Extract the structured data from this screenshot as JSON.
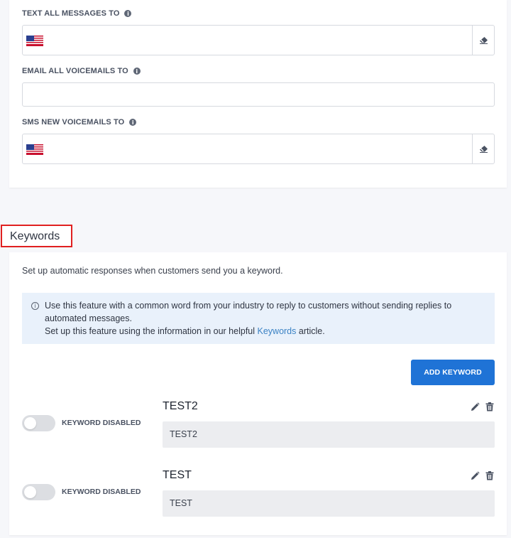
{
  "forwarding": {
    "text_messages_label": "TEXT ALL MESSAGES TO",
    "email_voicemails_label": "EMAIL ALL VOICEMAILS TO",
    "sms_voicemails_label": "SMS NEW VOICEMAILS TO",
    "text_messages_value": "",
    "email_voicemails_value": "",
    "sms_voicemails_value": "",
    "flag_icon": "us-flag-icon",
    "clear_icon": "eraser-icon",
    "info_icon": "info-icon"
  },
  "keywords": {
    "title": "Keywords",
    "description": "Set up automatic responses when customers send you a keyword.",
    "info_line1": "Use this feature with a common word from your industry to reply to customers without sending replies to",
    "info_line2": "automated messages.",
    "info_line3_prefix": "Set up this feature using the information in our helpful ",
    "info_link": "Keywords",
    "info_line3_suffix": " article.",
    "add_button": "ADD KEYWORD",
    "items": [
      {
        "name": "TEST2",
        "status": "KEYWORD DISABLED",
        "response": "TEST2",
        "enabled": false
      },
      {
        "name": "TEST",
        "status": "KEYWORD DISABLED",
        "response": "TEST",
        "enabled": false
      }
    ]
  },
  "colors": {
    "accent": "#1f73d6",
    "highlight_border": "#e02020",
    "info_background": "#e9f1fb",
    "link": "#3b82c4"
  }
}
